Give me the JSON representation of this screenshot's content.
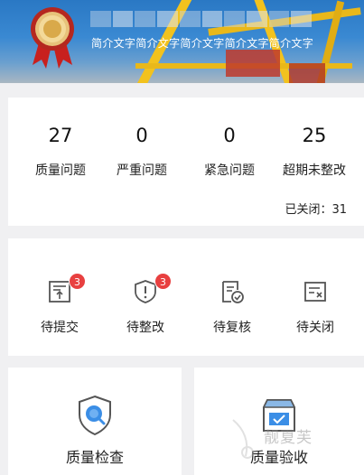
{
  "header": {
    "subtitle": "简介文字简介文字简介文字简介文字简介文字"
  },
  "stats": {
    "items": [
      {
        "value": "27",
        "label": "质量问题"
      },
      {
        "value": "0",
        "label": "严重问题"
      },
      {
        "value": "0",
        "label": "紧急问题"
      },
      {
        "value": "25",
        "label": "超期未整改"
      }
    ],
    "closed_text": "已关闭：31"
  },
  "actions": {
    "items": [
      {
        "label": "待提交",
        "badge": "3",
        "icon": "submit-doc-icon"
      },
      {
        "label": "待整改",
        "badge": "3",
        "icon": "warning-shield-icon"
      },
      {
        "label": "待复核",
        "badge": null,
        "icon": "review-check-icon"
      },
      {
        "label": "待关闭",
        "badge": null,
        "icon": "close-doc-icon"
      }
    ]
  },
  "modules": [
    {
      "label": "质量检查",
      "icon": "shield-search-icon"
    },
    {
      "label": "质量验收",
      "icon": "acceptance-box-icon"
    }
  ],
  "watermark": {
    "text": "靓夏芙",
    "icon": "watermark-logo-icon"
  },
  "colors": {
    "badge": "#e84040",
    "banner": "#2a78c4",
    "icon_blue": "#3b8ee6"
  }
}
